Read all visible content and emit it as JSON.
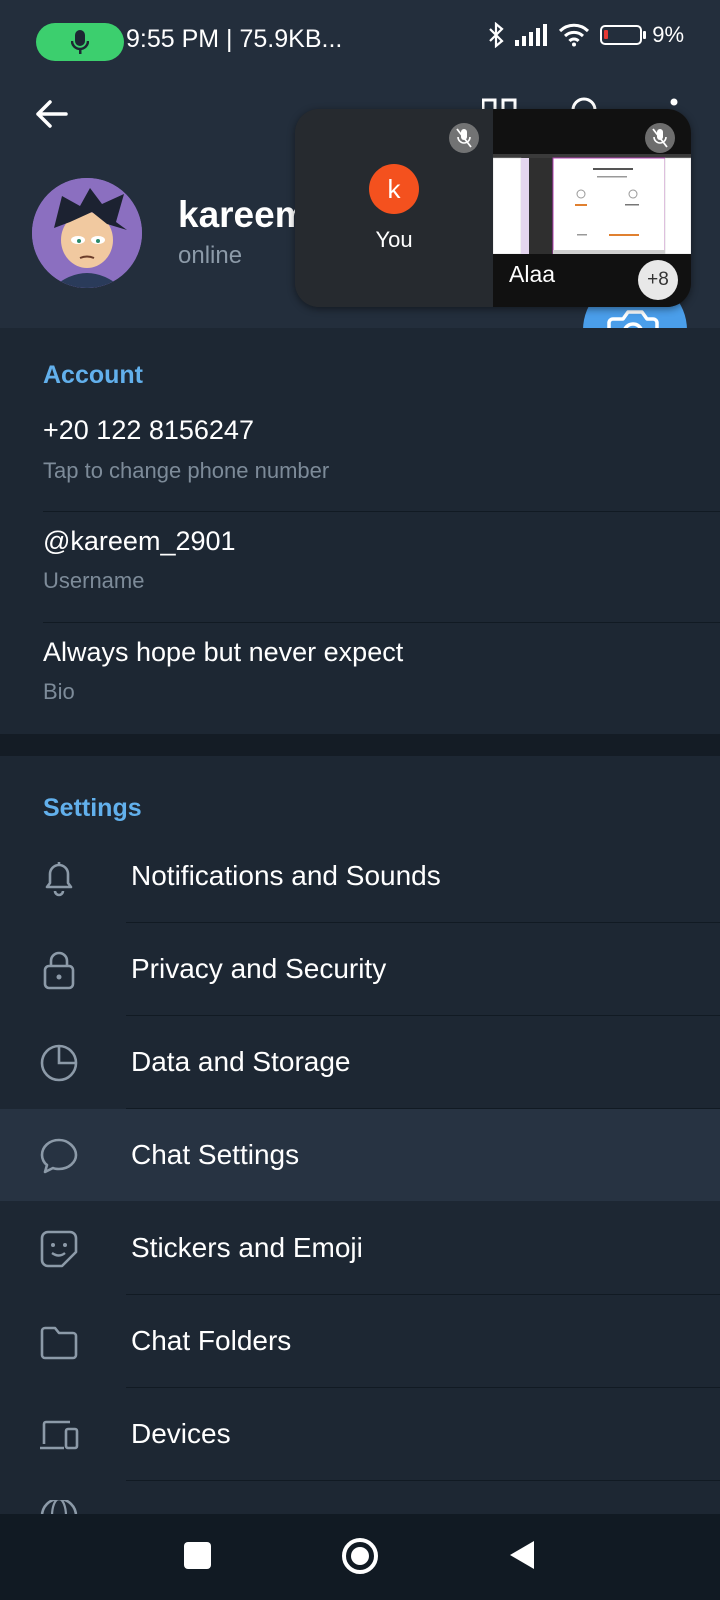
{
  "status_bar": {
    "time_text": "9:55 PM | 75.9KB...",
    "battery_percent": "9%",
    "icons": [
      "mic-icon",
      "bluetooth-icon",
      "signal-icon",
      "wifi-icon",
      "battery-icon"
    ]
  },
  "profile": {
    "name": "kareem",
    "status": "online"
  },
  "call_overlay": {
    "self_initial": "k",
    "self_label": "You",
    "speaker_label": "Alaa",
    "extra_count": "+8"
  },
  "account": {
    "section_title": "Account",
    "phone": "+20 122 8156247",
    "phone_hint": "Tap to change phone number",
    "username": "@kareem_2901",
    "username_label": "Username",
    "bio": "Always hope but never expect",
    "bio_label": "Bio"
  },
  "settings": {
    "section_title": "Settings",
    "items": [
      {
        "label": "Notifications and Sounds",
        "icon": "bell-icon"
      },
      {
        "label": "Privacy and Security",
        "icon": "lock-icon"
      },
      {
        "label": "Data and Storage",
        "icon": "pie-chart-icon"
      },
      {
        "label": "Chat Settings",
        "icon": "chat-bubble-icon"
      },
      {
        "label": "Stickers and Emoji",
        "icon": "sticker-icon"
      },
      {
        "label": "Chat Folders",
        "icon": "folder-icon"
      },
      {
        "label": "Devices",
        "icon": "devices-icon"
      }
    ]
  },
  "colors": {
    "accent": "#62b0ec",
    "background": "#1d2733",
    "header": "#232e3c",
    "fab": "#4a9eea",
    "mic_pill": "#3ccf6e"
  }
}
